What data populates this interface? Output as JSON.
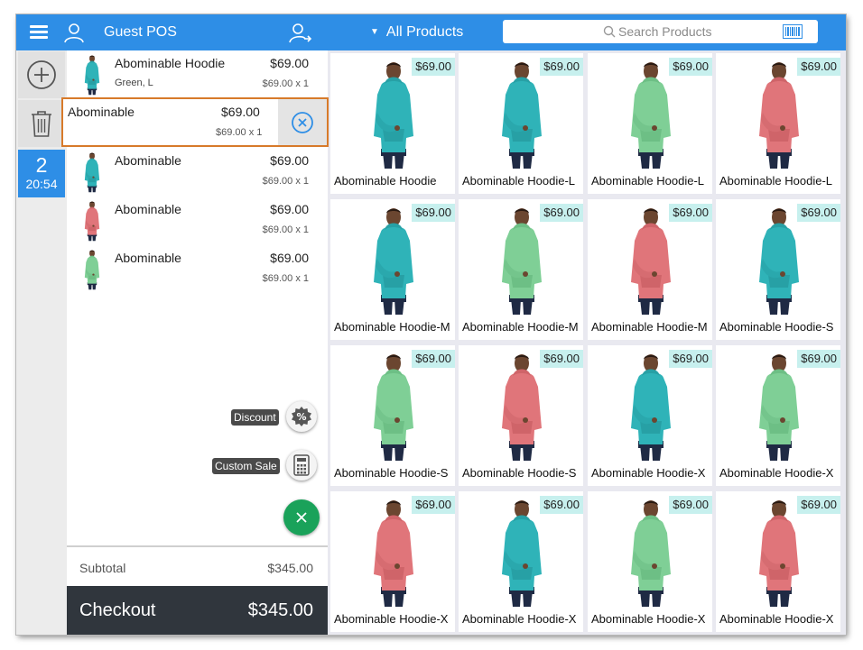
{
  "header": {
    "title": "Guest POS",
    "category": "All Products",
    "search_placeholder": "Search Products"
  },
  "session": {
    "count": "2",
    "time": "20:54"
  },
  "cart": {
    "items": [
      {
        "name": "Abominable Hoodie",
        "variant": "Green, L",
        "price": "$69.00",
        "qty": "$69.00 x 1",
        "color": "teal"
      },
      {
        "name": "Abominable",
        "variant": "",
        "price": "$69.00",
        "qty": "$69.00 x 1",
        "color": "teal"
      },
      {
        "name": "Abominable",
        "variant": "",
        "price": "$69.00",
        "qty": "$69.00 x 1",
        "color": "teal"
      },
      {
        "name": "Abominable",
        "variant": "",
        "price": "$69.00",
        "qty": "$69.00 x 1",
        "color": "red"
      },
      {
        "name": "Abominable",
        "variant": "",
        "price": "$69.00",
        "qty": "$69.00 x 1",
        "color": "green"
      }
    ],
    "discount_label": "Discount",
    "custom_sale_label": "Custom Sale",
    "subtotal_label": "Subtotal",
    "subtotal_value": "$345.00",
    "checkout_label": "Checkout",
    "checkout_total": "$345.00"
  },
  "products": [
    {
      "name": "Abominable Hoodie",
      "price": "$69.00",
      "color": "teal"
    },
    {
      "name": "Abominable Hoodie-L",
      "price": "$69.00",
      "color": "teal"
    },
    {
      "name": "Abominable Hoodie-L",
      "price": "$69.00",
      "color": "green"
    },
    {
      "name": "Abominable Hoodie-L",
      "price": "$69.00",
      "color": "red"
    },
    {
      "name": "Abominable Hoodie-M",
      "price": "$69.00",
      "color": "teal"
    },
    {
      "name": "Abominable Hoodie-M",
      "price": "$69.00",
      "color": "green"
    },
    {
      "name": "Abominable Hoodie-M",
      "price": "$69.00",
      "color": "red"
    },
    {
      "name": "Abominable Hoodie-S",
      "price": "$69.00",
      "color": "teal"
    },
    {
      "name": "Abominable Hoodie-S",
      "price": "$69.00",
      "color": "green"
    },
    {
      "name": "Abominable Hoodie-S",
      "price": "$69.00",
      "color": "red"
    },
    {
      "name": "Abominable Hoodie-X",
      "price": "$69.00",
      "color": "teal"
    },
    {
      "name": "Abominable Hoodie-X",
      "price": "$69.00",
      "color": "green"
    },
    {
      "name": "Abominable Hoodie-X",
      "price": "$69.00",
      "color": "red"
    },
    {
      "name": "Abominable Hoodie-X",
      "price": "$69.00",
      "color": "teal"
    },
    {
      "name": "Abominable Hoodie-X",
      "price": "$69.00",
      "color": "green"
    },
    {
      "name": "Abominable Hoodie-X",
      "price": "$69.00",
      "color": "red"
    }
  ],
  "colors": {
    "accent": "#2e8ee6",
    "checkout_bg": "#30363d",
    "price_badge": "#c7f0ee",
    "selection_border": "#d77a2a",
    "close_fab": "#1aa25a",
    "hoodie_teal": "#2fb3b8",
    "hoodie_green": "#7fcf96",
    "hoodie_red": "#e0757a"
  }
}
